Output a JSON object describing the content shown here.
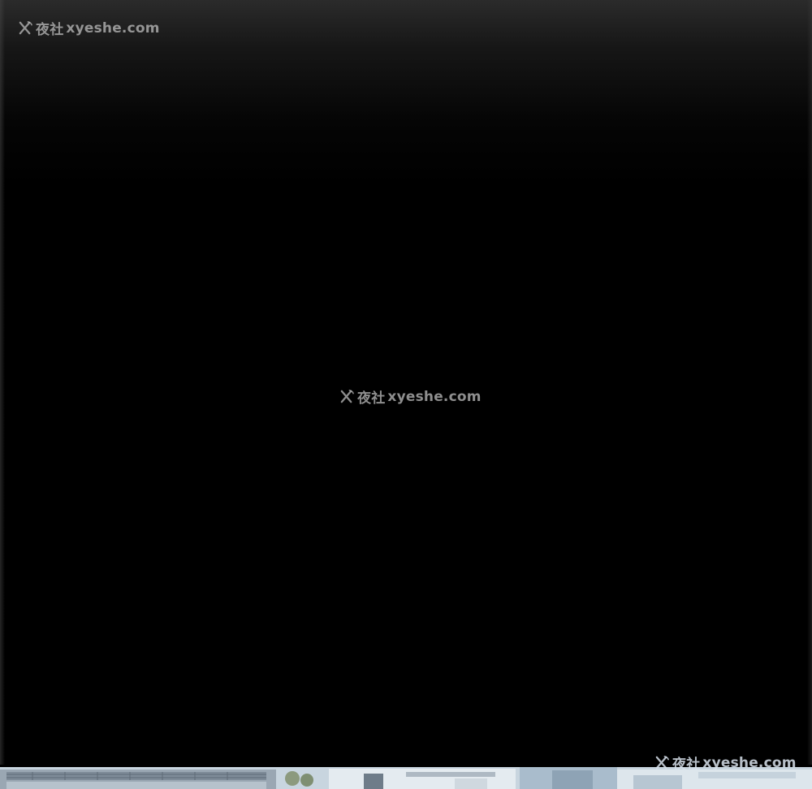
{
  "watermarks": {
    "top": {
      "brand": "夜社",
      "domain": "xyeshe.com",
      "icon": "x-logo-icon"
    },
    "center": {
      "brand": "夜社",
      "domain": "xyeshe.com",
      "icon": "x-logo-icon"
    },
    "bottom": {
      "brand": "夜社",
      "domain": "xyeshe.com",
      "icon": "x-logo-icon"
    }
  },
  "colors": {
    "background": "#000000",
    "top_fade": "#2b2b2b",
    "watermark": "#bebebe",
    "strip_sky": "#c9d6e0"
  }
}
